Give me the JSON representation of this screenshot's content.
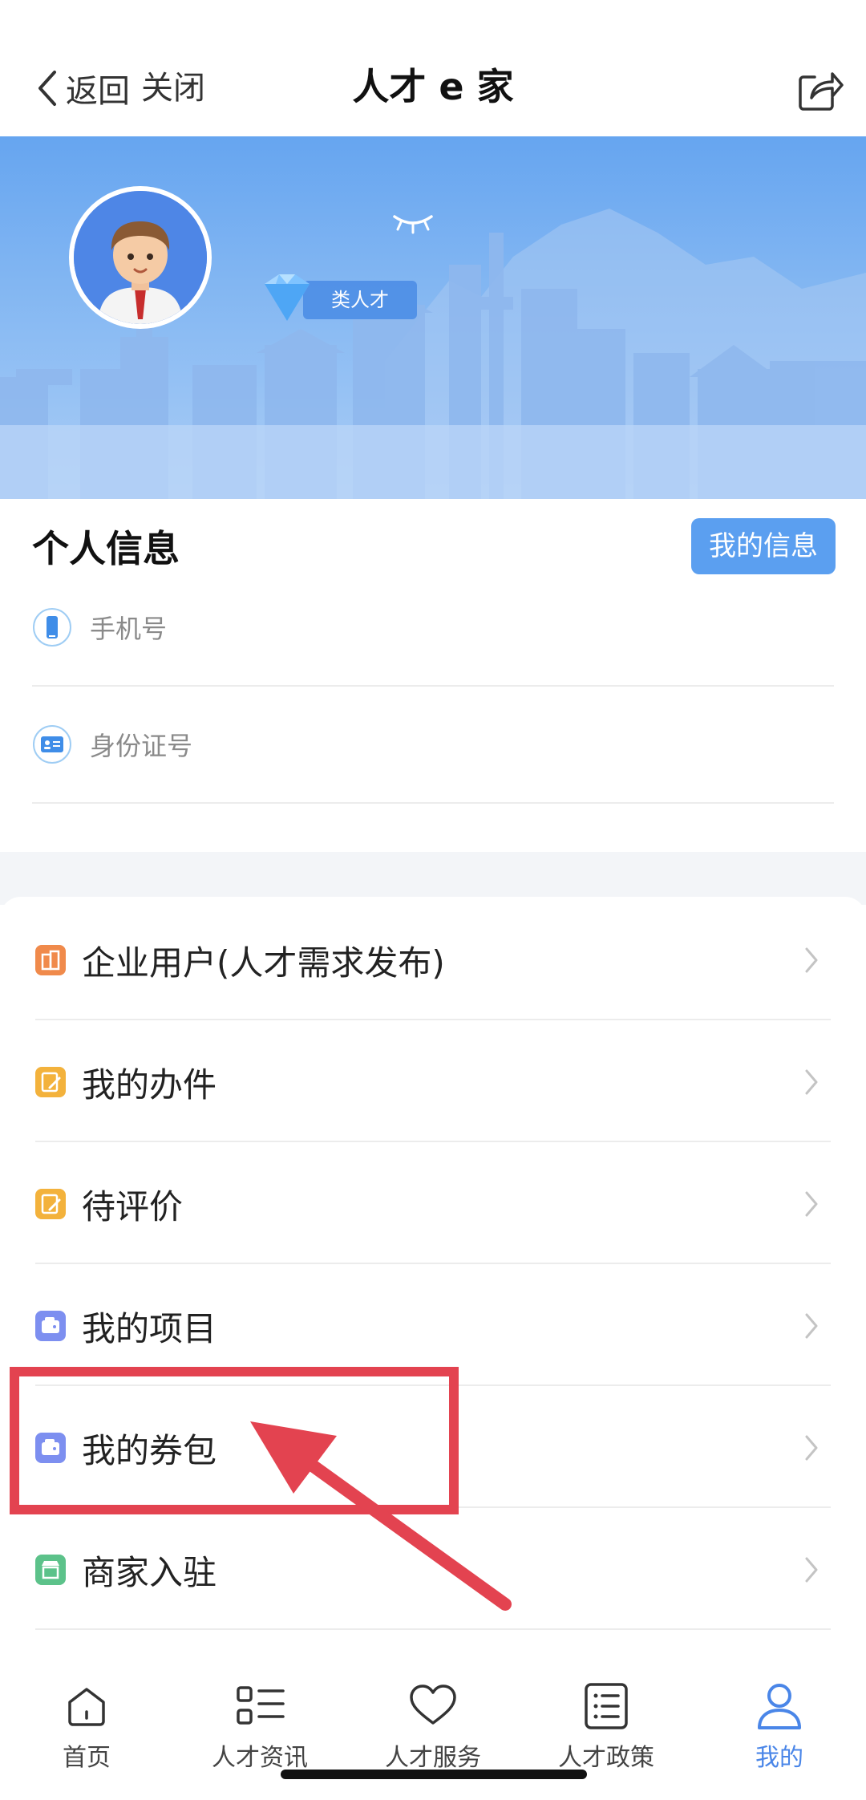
{
  "header": {
    "back_label": "返回",
    "close_label": "关闭",
    "title": "人才 e 家"
  },
  "profile": {
    "badge_label": "类人才"
  },
  "personal_info": {
    "title": "个人信息",
    "my_info_button": "我的信息",
    "phone_label": "手机号",
    "id_label": "身份证号"
  },
  "menu": {
    "items": [
      {
        "label": "企业用户(人才需求发布)",
        "icon": "enterprise-icon",
        "color": "#f08a4b"
      },
      {
        "label": "我的办件",
        "icon": "document-edit-icon",
        "color": "#f3b23c"
      },
      {
        "label": "待评价",
        "icon": "review-edit-icon",
        "color": "#f3b23c"
      },
      {
        "label": "我的项目",
        "icon": "wallet-icon",
        "color": "#7d8ff0"
      },
      {
        "label": "我的券包",
        "icon": "wallet-icon",
        "color": "#7d8ff0"
      },
      {
        "label": "商家入驻",
        "icon": "shop-icon",
        "color": "#5cc28a"
      }
    ]
  },
  "bottom_nav": {
    "items": [
      {
        "label": "首页",
        "icon": "home-icon"
      },
      {
        "label": "人才资讯",
        "icon": "list-icon"
      },
      {
        "label": "人才服务",
        "icon": "heart-icon"
      },
      {
        "label": "人才政策",
        "icon": "document-list-icon"
      },
      {
        "label": "我的",
        "icon": "user-icon",
        "active": true
      }
    ]
  },
  "colors": {
    "accent": "#5b9ff0",
    "annotation": "#e34350",
    "nav_active": "#4a86e8"
  }
}
